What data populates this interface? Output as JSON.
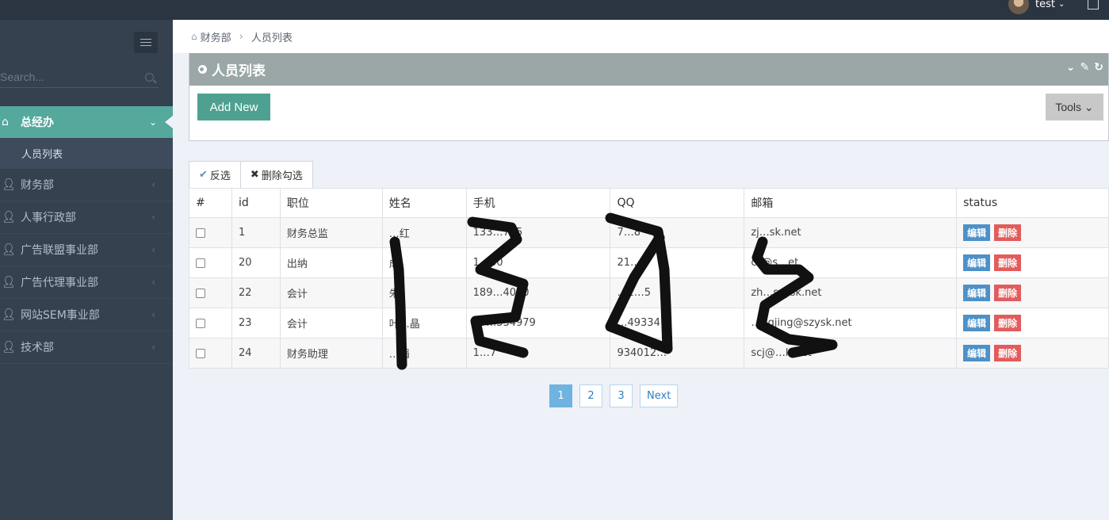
{
  "topbar": {
    "username": "test"
  },
  "sidebar": {
    "search_placeholder": "Search...",
    "menu": [
      {
        "label": "总经办",
        "active": true
      },
      {
        "label": "财务部"
      },
      {
        "label": "人事行政部"
      },
      {
        "label": "广告联盟事业部"
      },
      {
        "label": "广告代理事业部"
      },
      {
        "label": "网站SEM事业部"
      },
      {
        "label": "技术部"
      }
    ],
    "submenu_label": "人员列表"
  },
  "breadcrumb": {
    "level1": "财务部",
    "level2": "人员列表"
  },
  "portlet": {
    "title": "人员列表",
    "add_label": "Add New",
    "tools_label": "Tools"
  },
  "actions": {
    "invert_label": "反选",
    "delete_label": "删除勾选"
  },
  "table": {
    "headers": [
      "#",
      "id",
      "职位",
      "姓名",
      "手机",
      "QQ",
      "邮箱",
      "status"
    ],
    "rows": [
      {
        "id": "1",
        "position": "财务总监",
        "name": "…红",
        "phone": "133…725",
        "qq": "7…8",
        "email": "zj…sk.net"
      },
      {
        "id": "20",
        "position": "出纳",
        "name": "成",
        "phone": "1…60",
        "qq": "21…7",
        "email": "cz@s…et"
      },
      {
        "id": "22",
        "position": "会计",
        "name": "朱",
        "phone": "189…4020",
        "qq": "…2…5",
        "email": "zh…szysk.net"
      },
      {
        "id": "23",
        "position": "会计",
        "name": "叶…晶",
        "phone": "15…534979",
        "qq": "…49334",
        "email": "…ngjing@szysk.net"
      },
      {
        "id": "24",
        "position": "财务助理",
        "name": "…娟",
        "phone": "1…7",
        "qq": "934012…",
        "email": "scj@…k.net"
      }
    ],
    "edit_label": "编辑",
    "delete_label": "删除"
  },
  "pagination": {
    "pages": [
      "1",
      "2",
      "3"
    ],
    "next": "Next",
    "current": "1"
  }
}
